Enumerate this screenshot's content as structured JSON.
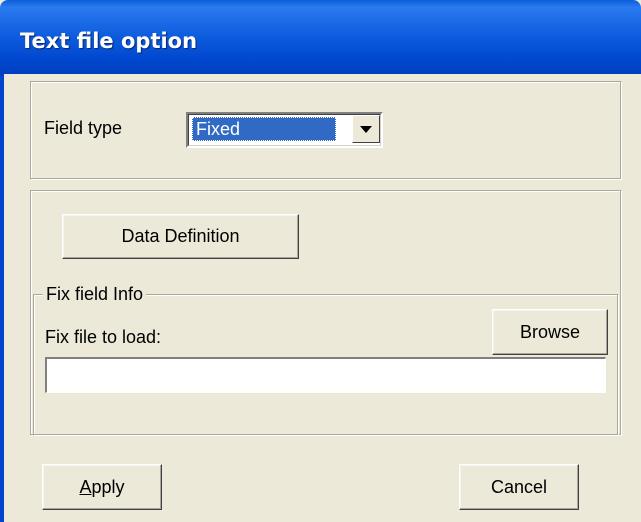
{
  "window": {
    "title": "Text file option"
  },
  "field_type": {
    "label": "Field type",
    "selected": "Fixed"
  },
  "data_definition": {
    "label": "Data Definition"
  },
  "fix_field": {
    "group_label": "Fix field Info",
    "file_label": "Fix file to load:",
    "browse_label": "Browse",
    "file_value": ""
  },
  "footer": {
    "apply_label": "Apply",
    "cancel_label": "Cancel"
  },
  "colors": {
    "titlebar": "#0054e3",
    "dialog_bg": "#ece9d8",
    "selection": "#316ac5"
  }
}
